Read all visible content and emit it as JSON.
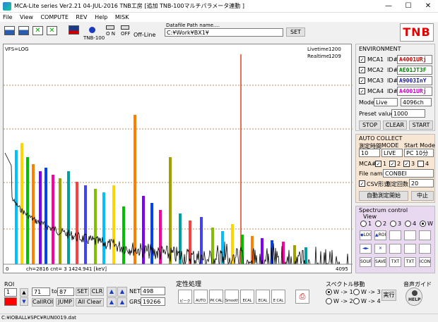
{
  "window": {
    "title": "MCA-Lite series   Ver2.21  04-JUL-2016 TNB工房 [追加   TNB-100マルチパラメータ連動 ]",
    "minimize": "—",
    "maximize": "☐",
    "close": "✕"
  },
  "menu": [
    "File",
    "View",
    "COMPUTE",
    "REV",
    "Help",
    "MISK"
  ],
  "toolbar": {
    "tnb100_label": "TNB-100",
    "on_label": "O N",
    "off_label": "OFF",
    "offline_label": "Off-Line",
    "datafile_caption": "Datafile Path name....",
    "datafile_path": "C:¥Work¥BX1¥",
    "set_label": "SET",
    "logo": "TNB"
  },
  "plot": {
    "vfs": "VFS=LOG",
    "livetime_label": "Livetime",
    "livetime_value": "1200",
    "realtime_label": "Realtime",
    "realtime_value": "1209",
    "x_min": "0",
    "x_max": "4095",
    "readout": "ch=2816    cnt=      3     1424.941 [keV]"
  },
  "environment": {
    "heading": "ENVIRONMENT",
    "id_label": "ID#",
    "mcas": [
      {
        "label": "MCA1",
        "id": "A4001URj",
        "color": "#c00000"
      },
      {
        "label": "MCA2",
        "id": "AE01JT3F",
        "color": "#008000"
      },
      {
        "label": "MCA3",
        "id": "A9003InY",
        "color": "#1a1aa0"
      },
      {
        "label": "MCA4",
        "id": "A4001URj",
        "color": "#c000c0"
      }
    ],
    "mode_label": "Mode",
    "mode_value": "Live",
    "ch_value": "4096ch",
    "preset_label": "Preset value",
    "preset_value": "1000",
    "stop": "STOP",
    "clear": "CLEAR",
    "start": "START"
  },
  "auto_collect": {
    "heading": "AUTO COLLECT",
    "time_label": "測定時間",
    "mode_label": "MODE",
    "startmode_label": "Start Mode",
    "time_value": "10",
    "mode_value": "LIVE",
    "startmode_value": "PC 10分",
    "mca_label": "MCA#",
    "mca_checks": [
      "1",
      "2",
      "3",
      "4"
    ],
    "filename_label": "File name",
    "filename_value": "CONBEI",
    "csv_label": "CSV形式",
    "count_label": "測定回数",
    "count_value": "20",
    "auto_start": "自動測定開始",
    "abort": "中止"
  },
  "spectrum_control": {
    "heading": "Spectrum control",
    "view_label": "View",
    "views": [
      "1",
      "2",
      "3",
      "4",
      "W"
    ],
    "buttons": [
      "LOG",
      "ROI",
      "",
      "",
      "",
      "",
      "",
      "",
      "",
      "",
      "SOURCE",
      "SAVE",
      "TXT",
      "TXT",
      "ICON"
    ]
  },
  "roi": {
    "heading": "ROI",
    "color_value": "1",
    "from": "71",
    "to_label": "to",
    "to": "87",
    "set": "SET",
    "clr": "CLR",
    "callroi": "CallROI",
    "jump": "JUMP",
    "allclear": "All Clear",
    "net_label": "NET",
    "net_value": "498",
    "grs_label": "GRS",
    "grs_value": "19266"
  },
  "qualitative": {
    "heading": "定性処理",
    "buttons": [
      "ピーク",
      "AUTO",
      "PK CAL",
      "Smooth",
      "ECAL",
      "ECAL",
      "E CAL"
    ]
  },
  "spectrum_move": {
    "heading": "スペクトル移動",
    "options": [
      "W -> 1",
      "W -> 3",
      "W -> 2",
      "W -> 4"
    ],
    "run": "実行"
  },
  "voice_guide": {
    "heading": "音声ガイド",
    "help": "HELP"
  },
  "status": {
    "path": "C:¥IOBALL¥SPC¥RUN0019.dat"
  },
  "colors": {
    "accent_red": "#e60000",
    "roi_red": "#ff0000"
  }
}
